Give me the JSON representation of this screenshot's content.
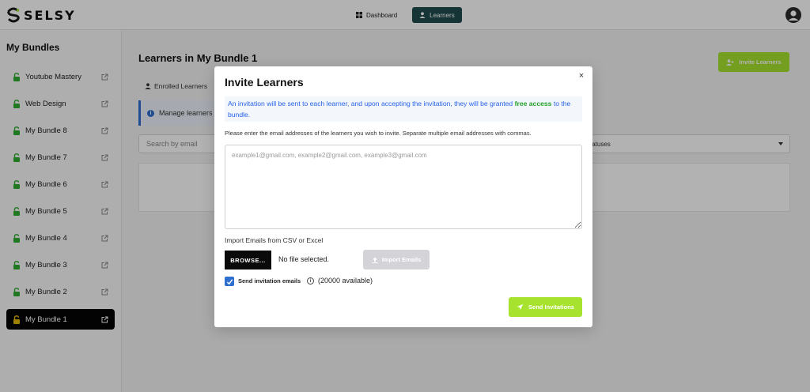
{
  "brand": {
    "name": "SELSY"
  },
  "nav": {
    "items": [
      {
        "label": "Dashboard",
        "active": false
      },
      {
        "label": "Learners",
        "active": true
      }
    ]
  },
  "sidebar": {
    "title": "My Bundles",
    "items": [
      {
        "label": "Youtube Mastery",
        "active": false
      },
      {
        "label": "Web Design",
        "active": false
      },
      {
        "label": "My Bundle 8",
        "active": false
      },
      {
        "label": "My Bundle 7",
        "active": false
      },
      {
        "label": "My Bundle 6",
        "active": false
      },
      {
        "label": "My Bundle 5",
        "active": false
      },
      {
        "label": "My Bundle 4",
        "active": false
      },
      {
        "label": "My Bundle 3",
        "active": false
      },
      {
        "label": "My Bundle 2",
        "active": false
      },
      {
        "label": "My Bundle 1",
        "active": true
      }
    ]
  },
  "main": {
    "title": "Learners in My Bundle 1",
    "invite_button": "Invite Learners",
    "tab_enrolled": "Enrolled Learners",
    "info_text": "Manage learners",
    "search_placeholder": "Search by email",
    "status_select": "tatuses"
  },
  "modal": {
    "title": "Invite Learners",
    "close": "×",
    "notice_before": "An invitation will be sent to each learner, and upon accepting the invitation, they will be granted ",
    "notice_highlight": "free access",
    "notice_after": " to the bundle.",
    "instructions": "Please enter the email addresses of the learners you wish to invite. Separate multiple email addresses with commas.",
    "textarea_placeholder": "example1@gmail.com, example2@gmail.com, example3@gmail.com",
    "textarea_value": "",
    "import_label": "Import Emails from CSV or Excel",
    "browse_label": "BROWSE...",
    "file_status": "No file selected.",
    "import_button": "Import Emails",
    "send_checkbox_label": "Send invitation emails",
    "send_checkbox_checked": true,
    "available_text": "(20000 available)",
    "send_button": "Send Invitations"
  },
  "colors": {
    "accent_green": "#a6e22e",
    "nav_active": "#1f4b4d",
    "link_blue": "#2563eb",
    "highlight_green": "#22a02a",
    "checkbox_blue": "#2f6fd0"
  }
}
